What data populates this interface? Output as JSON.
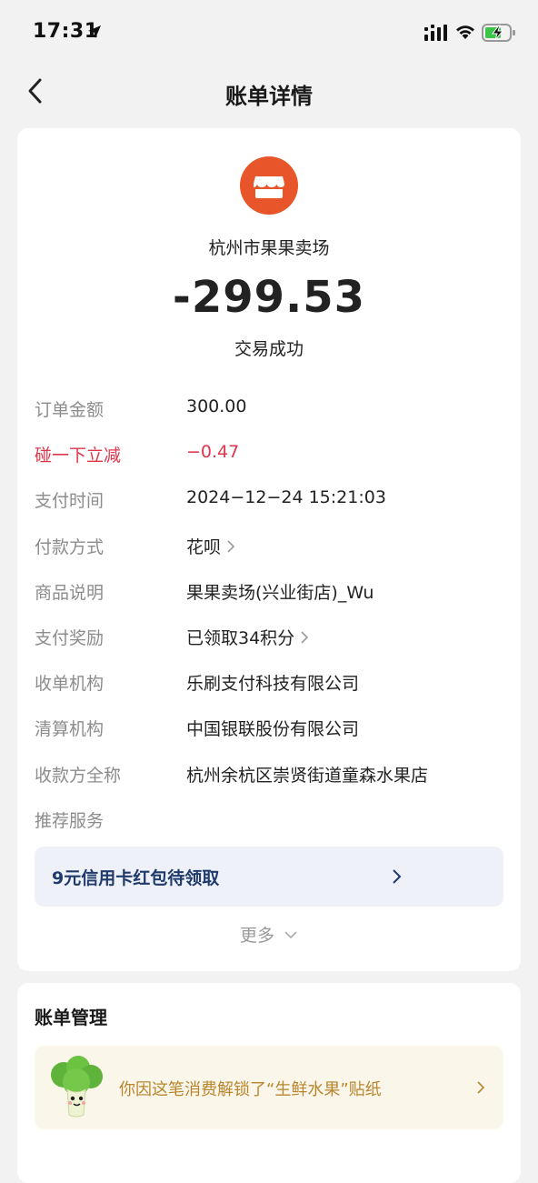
{
  "status_bar": {
    "time": "17:31"
  },
  "nav": {
    "title": "账单详情"
  },
  "summary": {
    "merchant_name": "杭州市果果卖场",
    "amount": "-299.53",
    "status": "交易成功",
    "logo_color": "#e8552a"
  },
  "details": [
    {
      "label": "订单金额",
      "value": "300.00"
    },
    {
      "label": "碰一下立减",
      "value": "−0.47"
    },
    {
      "label": "支付时间",
      "value": "2024−12−24 15:21:03"
    },
    {
      "label": "付款方式",
      "value": "花呗"
    },
    {
      "label": "商品说明",
      "value": "果果卖场(兴业街店)_Wu"
    },
    {
      "label": "支付奖励",
      "value": "已领取34积分"
    },
    {
      "label": "收单机构",
      "value": "乐刷支付科技有限公司"
    },
    {
      "label": "清算机构",
      "value": "中国银联股份有限公司"
    },
    {
      "label": "收款方全称",
      "value": "杭州余杭区崇贤街道童森水果店"
    },
    {
      "label": "推荐服务",
      "value": ""
    }
  ],
  "promo": {
    "text": "9元信用卡红包待领取"
  },
  "more_label": "更多",
  "bill_management": {
    "title": "账单管理",
    "sticker_text": "你因这笔消费解锁了“生鲜水果”贴纸"
  },
  "colors": {
    "discount_red": "#e0354a",
    "label_gray": "#8c8c8c",
    "promo_blue": "#1f3a6b",
    "sticker_gold": "#b8862e"
  }
}
